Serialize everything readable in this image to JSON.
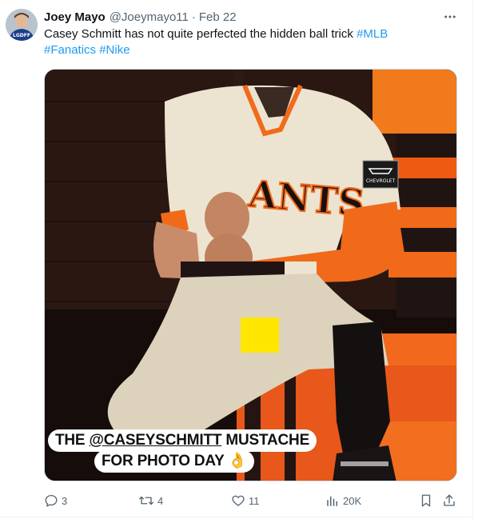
{
  "tweet": {
    "author": {
      "display_name": "Joey Mayo",
      "handle": "@Joeymayo11",
      "avatar_text": "LGDFF"
    },
    "separator": "·",
    "date": "Feb 22",
    "text_plain": "Casey Schmitt has not quite perfected the hidden ball trick",
    "hashtags": [
      "#MLB",
      "#Fanatics",
      "#Nike"
    ],
    "media": {
      "jersey_text": "ANTS",
      "patch_text": "CHEVROLET",
      "caption_line1_prefix": "THE ",
      "caption_mention": "@CASEYSCHMITT",
      "caption_line1_suffix": " MUSTACHE",
      "caption_line2": "FOR PHOTO DAY 👌"
    },
    "actions": {
      "replies": "3",
      "reposts": "4",
      "likes": "11",
      "views": "20K"
    }
  },
  "colors": {
    "link": "#1d9bf0",
    "secondary_text": "#536471",
    "jersey_cream": "#ece4d0",
    "giants_orange": "#f26a1b",
    "censor_yellow": "#ffe600"
  },
  "icons": {
    "more": "ellipsis-icon",
    "reply": "reply-icon",
    "repost": "repost-icon",
    "like": "heart-icon",
    "views": "bar-chart-icon",
    "bookmark": "bookmark-icon",
    "share": "share-icon"
  }
}
